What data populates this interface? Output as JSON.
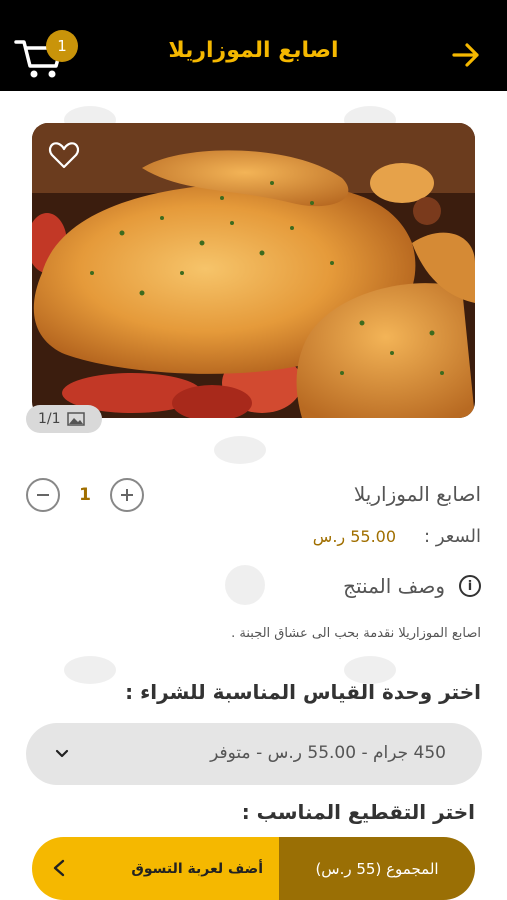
{
  "header": {
    "title": "اصابع الموزاريلا",
    "cart_count": "1"
  },
  "gallery": {
    "counter": "1/1"
  },
  "product": {
    "name": "اصابع الموزاريلا",
    "quantity": "1",
    "price_label": "السعر :",
    "price_value": "55.00 ر.س",
    "description_title": "وصف المنتج",
    "description": "اصابع الموزاريلا نقدمة بحب الى عشاق الجبنة ."
  },
  "measure": {
    "heading": "اختر وحدة القياس المناسبة للشراء :",
    "selected": "450 جرام - 55.00 ر.س - متوفر"
  },
  "cut": {
    "heading": "اختر التقطيع المناسب :"
  },
  "cta": {
    "add_label": "أضف لعربة التسوق",
    "total_label": "المجموع (55 ر.س)"
  },
  "colors": {
    "accent": "#f5b800",
    "accent_dark": "#9a6f05",
    "header_bg": "#000000"
  }
}
